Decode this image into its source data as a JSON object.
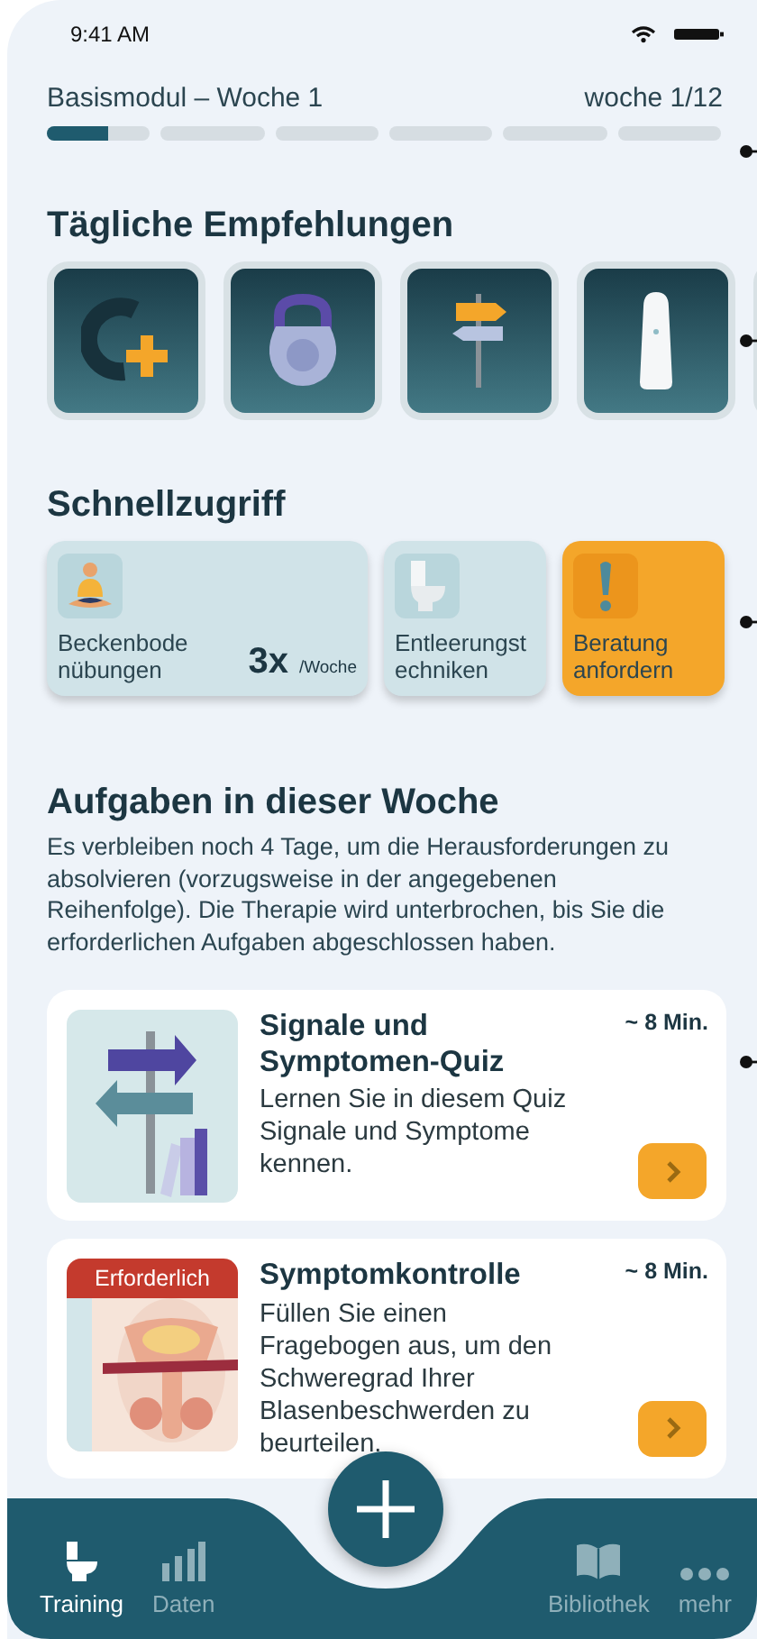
{
  "status_bar": {
    "time": "9:41 AM"
  },
  "module": {
    "title": "Basismodul – Woche 1",
    "week": "woche 1/12",
    "segments": [
      {
        "level": 0.6
      },
      {
        "level": 0
      },
      {
        "level": 0
      },
      {
        "level": 0
      },
      {
        "level": 0
      },
      {
        "level": 0
      }
    ]
  },
  "daily": {
    "heading": "Tägliche Empfehlungen",
    "tiles": [
      {
        "kind": "plus"
      },
      {
        "kind": "kettlebell"
      },
      {
        "kind": "signpost"
      },
      {
        "kind": "device"
      },
      {
        "kind": "blank"
      }
    ]
  },
  "quick": {
    "heading": "Schnellzugriff",
    "cards": [
      {
        "kind": "exercise",
        "lines": [
          "Beckenbode",
          "nübungen"
        ],
        "count": "3x",
        "unit": "/Woche",
        "highlighted": false
      },
      {
        "kind": "toilet",
        "lines": [
          "Entleerungst",
          "echniken"
        ],
        "highlighted": false
      },
      {
        "kind": "alert",
        "lines": [
          "Beratung",
          "anfordern"
        ],
        "highlighted": true
      }
    ]
  },
  "tasks": {
    "heading": "Aufgaben in dieser Woche",
    "intro": "Es verbleiben noch 4 Tage, um die Herausforderungen zu absolvieren (vorzugsweise in der angegebenen Reihenfolge). Die Therapie wird unterbrochen, bis Sie die erforderlichen Aufgaben abgeschlossen haben.",
    "items": [
      {
        "kind": "signpost",
        "title": "Signale und Symptomen-Quiz",
        "duration": "~ 8 Min.",
        "description": "Lernen Sie in diesem Quiz Signale und Symptome kennen."
      },
      {
        "kind": "body",
        "badge": "Erforderlich",
        "title": "Symptomkontrolle",
        "duration": "~ 8 Min.",
        "description": "Füllen Sie einen Fragebogen aus, um den Schweregrad Ihrer Blasenbeschwerden zu beurteilen."
      }
    ]
  },
  "tab_bar": [
    {
      "label": "Training",
      "kind": "toilet",
      "selected": true
    },
    {
      "label": "Daten",
      "kind": "chart",
      "selected": false
    },
    {
      "label": "Bibliothek",
      "kind": "book",
      "selected": false
    },
    {
      "label": "mehr",
      "kind": "dots",
      "selected": false
    }
  ]
}
